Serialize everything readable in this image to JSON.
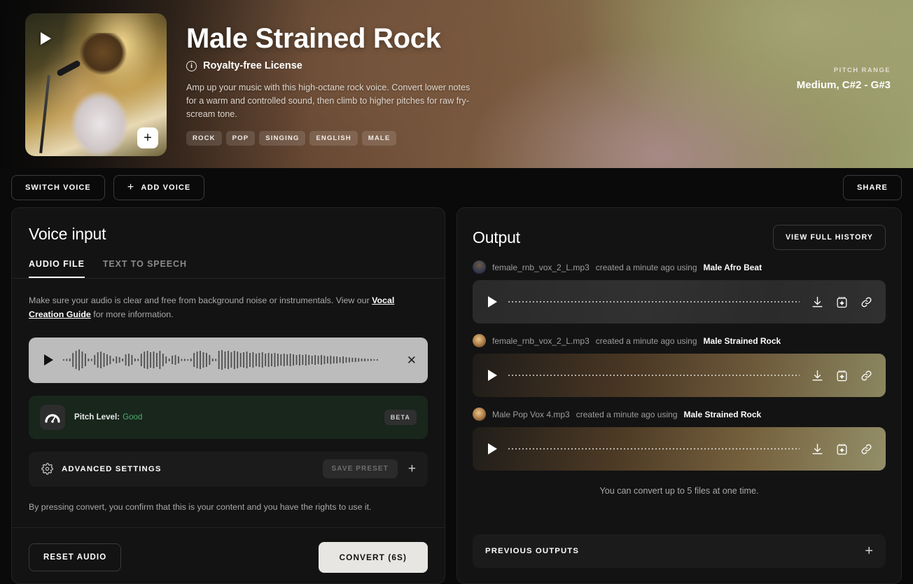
{
  "hero": {
    "title": "Male Strained Rock",
    "license": "Royalty-free License",
    "info_icon": "info-icon",
    "description": "Amp up your music with this high-octane rock voice. Convert lower notes for a warm and controlled sound, then climb to higher pitches for raw fry-scream tone.",
    "tags": [
      "ROCK",
      "POP",
      "SINGING",
      "ENGLISH",
      "MALE"
    ],
    "pitch_range_label": "PITCH RANGE",
    "pitch_range_value": "Medium, C#2 - G#3",
    "play_icon": "play-icon",
    "add_icon": "plus-icon"
  },
  "toolbar": {
    "switch_voice": "SWITCH VOICE",
    "add_voice": "ADD VOICE",
    "share": "SHARE"
  },
  "voice_input": {
    "title": "Voice input",
    "tabs": [
      {
        "label": "AUDIO FILE",
        "active": true
      },
      {
        "label": "TEXT TO SPEECH",
        "active": false
      }
    ],
    "helper_text_before": "Make sure your audio is clear and free from background noise or instrumentals. View our ",
    "helper_link": "Vocal Creation Guide",
    "helper_text_after": " for more information.",
    "player": {
      "play_icon": "play-icon",
      "remove_icon": "close-icon"
    },
    "pitch_level": {
      "icon": "gauge-icon",
      "label": "Pitch Level:",
      "value": "Good",
      "value_color": "#4ea96f",
      "badge": "BETA"
    },
    "advanced_settings": {
      "icon": "gear-icon",
      "label": "ADVANCED SETTINGS",
      "save_preset": "SAVE PRESET",
      "expand_icon": "plus-icon"
    },
    "disclaimer": "By pressing convert, you confirm that this is your content and you have the rights to use it.",
    "reset_button": "RESET AUDIO",
    "convert_button": "CONVERT (6S)"
  },
  "output": {
    "title": "Output",
    "view_history_button": "VIEW FULL HISTORY",
    "items": [
      {
        "file": "female_rnb_vox_2_L.mp3",
        "created": "created a minute ago using",
        "voice": "Male Afro Beat"
      },
      {
        "file": "female_rnb_vox_2_L.mp3",
        "created": "created a minute ago using",
        "voice": "Male Strained Rock"
      },
      {
        "file": "Male Pop Vox 4.mp3",
        "created": "created a minute ago using",
        "voice": "Male Strained Rock"
      }
    ],
    "row_actions": [
      "download-icon",
      "add-to-project-icon",
      "copy-link-icon"
    ],
    "convert_note": "You can convert up to 5 files at one time.",
    "previous_outputs": "PREVIOUS OUTPUTS",
    "previous_outputs_icon": "plus-icon"
  }
}
